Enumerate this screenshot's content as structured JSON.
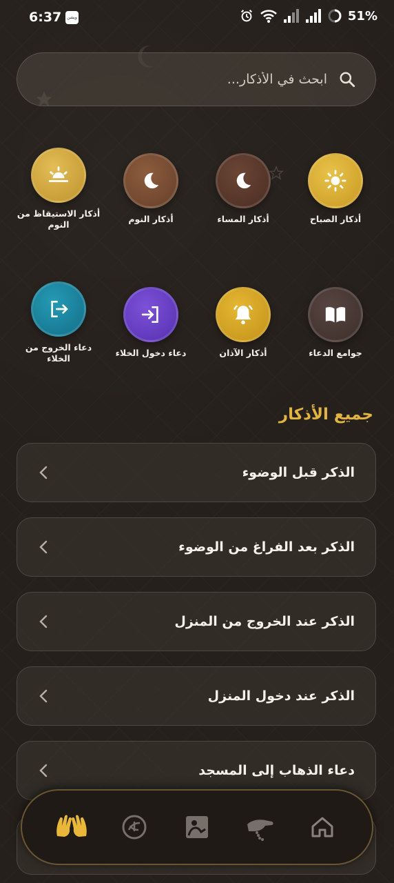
{
  "status_bar": {
    "time": "6:37",
    "app_badge": "ويشن",
    "battery": "51%"
  },
  "search": {
    "placeholder": "ابحث في الأذكار..."
  },
  "categories": [
    {
      "label": "أذكار الصباح",
      "icon": "sun-icon",
      "color": "#d9ad2f"
    },
    {
      "label": "أذكار المساء",
      "icon": "moon-icon",
      "color": "#5a3a2c"
    },
    {
      "label": "أذكار النوم",
      "icon": "moon-icon",
      "color": "#7a4e33"
    },
    {
      "label": "أذكار الاستيقاظ من النوم",
      "icon": "sunrise-icon",
      "color": "#d4aa3c"
    },
    {
      "label": "جوامع الدعاء",
      "icon": "open-book-icon",
      "color": "#4b3a34"
    },
    {
      "label": "أذكار الآذان",
      "icon": "bell-icon",
      "color": "#d5a424"
    },
    {
      "label": "دعاء دخول الخلاء",
      "icon": "enter-icon",
      "color": "#6a3fc4"
    },
    {
      "label": "دعاء الخروج من الخلاء",
      "icon": "exit-icon",
      "color": "#1b87a0"
    }
  ],
  "section": {
    "title": "جميع الأذكار"
  },
  "list": [
    {
      "title": "الذكر قبل الوضوء"
    },
    {
      "title": "الذكر بعد الفراغ من الوضوء"
    },
    {
      "title": "الذكر عند الخروج من المنزل"
    },
    {
      "title": "الذكر عند دخول المنزل"
    },
    {
      "title": "دعاء الذهاب إلى المسجد"
    }
  ],
  "bottom_nav": [
    {
      "icon": "praying-hands-icon",
      "active": true
    },
    {
      "icon": "quran-icon",
      "active": false
    },
    {
      "icon": "reading-icon",
      "active": false
    },
    {
      "icon": "prayer-beads-hand-icon",
      "active": false
    },
    {
      "icon": "home-icon",
      "active": false
    }
  ],
  "colors": {
    "accent": "#e2b441",
    "background": "#25201c",
    "card_bg": "#3c3630"
  }
}
